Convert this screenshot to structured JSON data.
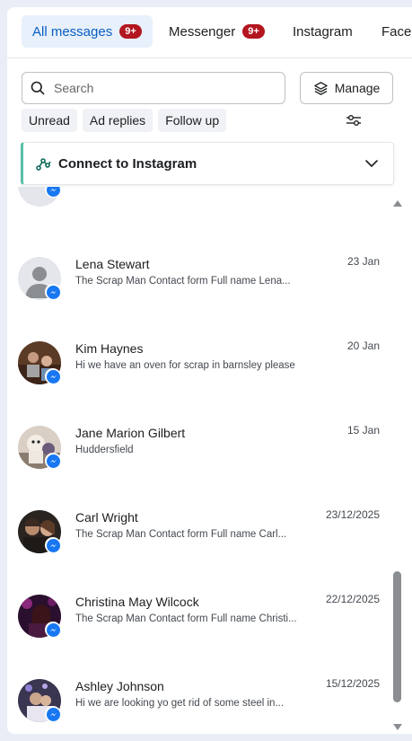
{
  "tabs": [
    {
      "label": "All messages",
      "badge": "9+"
    },
    {
      "label": "Messenger",
      "badge": "9+"
    },
    {
      "label": "Instagram"
    },
    {
      "label": "Facebook"
    }
  ],
  "search": {
    "placeholder": "Search",
    "value": ""
  },
  "manage_label": "Manage",
  "filters": [
    "Unread",
    "Ad replies",
    "Follow up"
  ],
  "connect_banner": {
    "title": "Connect to Instagram"
  },
  "conversations": [
    {
      "name": "Lena Stewart",
      "snippet": "The Scrap Man Contact form Full name Lena...",
      "date": "23 Jan",
      "platform_icon": "messenger-icon"
    },
    {
      "name": "Kim Haynes",
      "snippet": "Hi we have an oven for scrap in barnsley please",
      "date": "20 Jan",
      "platform_icon": "messenger-icon"
    },
    {
      "name": "Jane Marion Gilbert",
      "snippet": "Huddersfield",
      "date": "15 Jan",
      "platform_icon": "messenger-icon"
    },
    {
      "name": "Carl Wright",
      "snippet": "The Scrap Man Contact form Full name Carl...",
      "date": "23/12/2025",
      "platform_icon": "messenger-icon"
    },
    {
      "name": "Christina May Wilcock",
      "snippet": "The Scrap Man Contact form Full name Christi...",
      "date": "22/12/2025",
      "platform_icon": "messenger-icon"
    },
    {
      "name": "Ashley Johnson",
      "snippet": "Hi we are looking yo get rid of some steel in...",
      "date": "15/12/2025",
      "platform_icon": "messenger-icon"
    }
  ],
  "colors": {
    "accent": "#0a5dc2",
    "badge": "#b3161f",
    "messenger": "#1877f2",
    "connect_bar": "#58c0a8"
  }
}
